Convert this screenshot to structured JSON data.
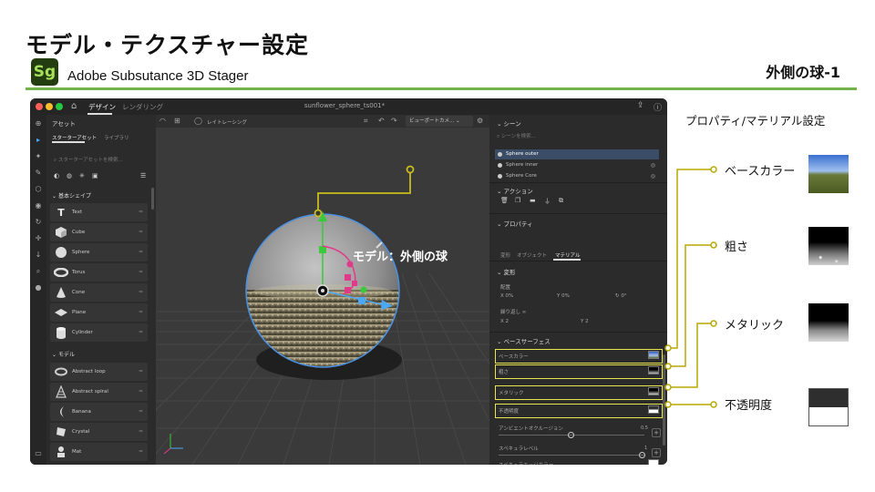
{
  "slide": {
    "title": "モデル・テクスチャー設定",
    "app_logo": "Sg",
    "app_name": "Adobe Subsutance 3D Stager",
    "subtitle": "外側の球-1",
    "accent_color": "#74b24b"
  },
  "window": {
    "mode_tabs": [
      "デザイン",
      "レンダリング"
    ],
    "document_title": "sunflower_sphere_ts001*"
  },
  "assets_panel": {
    "title": "アセット",
    "tabs": [
      "スターターアセット",
      "ライブラリ"
    ],
    "search_placeholder": "スターターアセットを検索...",
    "basic_shapes_header": "基本シェイプ",
    "basic_shapes": [
      {
        "label": "Text",
        "icon": "text-glyph-icon"
      },
      {
        "label": "Cube",
        "icon": "cube-icon"
      },
      {
        "label": "Sphere",
        "icon": "sphere-icon"
      },
      {
        "label": "Torus",
        "icon": "torus-icon"
      },
      {
        "label": "Cone",
        "icon": "cone-icon"
      },
      {
        "label": "Plane",
        "icon": "plane-icon"
      },
      {
        "label": "Cylinder",
        "icon": "cylinder-icon"
      }
    ],
    "models_header": "モデル",
    "models": [
      {
        "label": "Abstract loop",
        "icon": "abstract-loop-icon"
      },
      {
        "label": "Abstract spiral",
        "icon": "abstract-spiral-icon"
      },
      {
        "label": "Banana",
        "icon": "banana-icon"
      },
      {
        "label": "Crystal",
        "icon": "crystal-icon"
      },
      {
        "label": "Mat",
        "icon": "mat-icon"
      }
    ]
  },
  "viewport": {
    "raytracing_label": "レイトレーシング",
    "camera_label": "ビューポートカメ...",
    "callout": "モデル：外側の球"
  },
  "scene_panel": {
    "title": "シーン",
    "search_placeholder": "シーンを検索...",
    "items": [
      "Sphere outer",
      "Sphere inner",
      "Sphere Core"
    ],
    "actions_header": "アクション",
    "properties_header": "プロパティ",
    "property_tabs": [
      "変形",
      "オブジェクト",
      "マテリアル"
    ],
    "transform_header": "変形",
    "placement_label": "配置",
    "x_pos": "X 0%",
    "y_pos": "Y 0%",
    "rotation": "0°",
    "repeat_label": "繰り返し",
    "x_repeat": "X 2",
    "y_repeat": "Y 2",
    "base_surface_header": "ベースサーフェス",
    "base_color": "ベースカラー",
    "roughness": "粗さ",
    "metallic": "メタリック",
    "opacity": "不透明度",
    "ambient_occlusion": "アンビエントオクルージョン",
    "ambient_occlusion_value": "0.5",
    "specular_level": "スペキュラレベル",
    "specular_level_value": "1",
    "specular_edge_color": "スペキュラエッジカラー"
  },
  "annotations": {
    "heading": "プロパティ/マテリアル設定",
    "labels": [
      "ベースカラー",
      "粗さ",
      "メタリック",
      "不透明度"
    ],
    "line_color": "#b8a800"
  }
}
